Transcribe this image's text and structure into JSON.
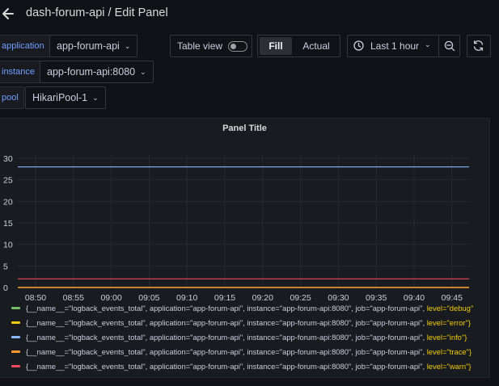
{
  "header": {
    "title": "dash-forum-api / Edit Panel"
  },
  "variables": [
    {
      "label": "application",
      "value": "app-forum-api"
    },
    {
      "label": "instance",
      "value": "app-forum-api:8080"
    },
    {
      "label": "pool",
      "value": "HikariPool-1"
    }
  ],
  "toolbar": {
    "table_view_label": "Table view",
    "table_view_enabled": false,
    "fill_label": "Fill",
    "actual_label": "Actual",
    "selected_mode": "Fill",
    "time_range_label": "Last 1 hour"
  },
  "panel": {
    "title": "Panel Title"
  },
  "chart_data": {
    "type": "line",
    "title": "Panel Title",
    "x": [
      "08:50",
      "08:55",
      "09:00",
      "09:05",
      "09:10",
      "09:15",
      "09:20",
      "09:25",
      "09:30",
      "09:35",
      "09:40",
      "09:45"
    ],
    "ylim": [
      0,
      30
    ],
    "y_ticks": [
      "0",
      "5",
      "10",
      "15",
      "20",
      "25",
      "30"
    ],
    "grid": true,
    "legend_position": "bottom",
    "series": [
      {
        "name": "{__name__=\"logback_events_total\", application=\"app-forum-api\", instance=\"app-forum-api:8080\", job=\"app-forum-api\", level=\"debug\"}",
        "color": "#73bf69",
        "values": [
          0,
          0,
          0,
          0,
          0,
          0,
          0,
          0,
          0,
          0,
          0,
          0
        ]
      },
      {
        "name": "{__name__=\"logback_events_total\", application=\"app-forum-api\", instance=\"app-forum-api:8080\", job=\"app-forum-api\", level=\"error\"}",
        "color": "#f2cc0c",
        "values": [
          0,
          0,
          0,
          0,
          0,
          0,
          0,
          0,
          0,
          0,
          0,
          0
        ]
      },
      {
        "name": "{__name__=\"logback_events_total\", application=\"app-forum-api\", instance=\"app-forum-api:8080\", job=\"app-forum-api\", level=\"info\"}",
        "color": "#8ab8ff",
        "values": [
          28,
          28,
          28,
          28,
          28,
          28,
          28,
          28,
          28,
          28,
          28,
          28
        ]
      },
      {
        "name": "{__name__=\"logback_events_total\", application=\"app-forum-api\", instance=\"app-forum-api:8080\", job=\"app-forum-api\", level=\"trace\"}",
        "color": "#ff9830",
        "values": [
          0,
          0,
          0,
          0,
          0,
          0,
          0,
          0,
          0,
          0,
          0,
          0
        ]
      },
      {
        "name": "{__name__=\"logback_events_total\", application=\"app-forum-api\", instance=\"app-forum-api:8080\", job=\"app-forum-api\", level=\"warn\"}",
        "color": "#f2495c",
        "values": [
          2,
          2,
          2,
          2,
          2,
          2,
          2,
          2,
          2,
          2,
          2,
          2
        ]
      }
    ]
  },
  "legend": [
    {
      "prefix": "{__name__=\"logback_events_total\", application=\"app-forum-api\", instance=\"app-forum-api:8080\", job=\"app-forum-api\", ",
      "level": "level=\"debug\"",
      "color": "#73bf69"
    },
    {
      "prefix": "{__name__=\"logback_events_total\", application=\"app-forum-api\", instance=\"app-forum-api:8080\", job=\"app-forum-api\", ",
      "level": "level=\"error\"}",
      "color": "#f2cc0c"
    },
    {
      "prefix": "{__name__=\"logback_events_total\", application=\"app-forum-api\", instance=\"app-forum-api:8080\", job=\"app-forum-api\", ",
      "level": "level=\"info\"}",
      "color": "#8ab8ff"
    },
    {
      "prefix": "{__name__=\"logback_events_total\", application=\"app-forum-api\", instance=\"app-forum-api:8080\", job=\"app-forum-api\", ",
      "level": "level=\"trace\"}",
      "color": "#ff9830"
    },
    {
      "prefix": "{__name__=\"logback_events_total\", application=\"app-forum-api\", instance=\"app-forum-api:8080\", job=\"app-forum-api\", ",
      "level": "level=\"warn\"}",
      "color": "#f2495c"
    }
  ],
  "icons": {
    "back": "arrow-left-icon",
    "clock": "clock-icon",
    "zoom_out": "zoom-out-icon",
    "refresh": "refresh-icon"
  }
}
